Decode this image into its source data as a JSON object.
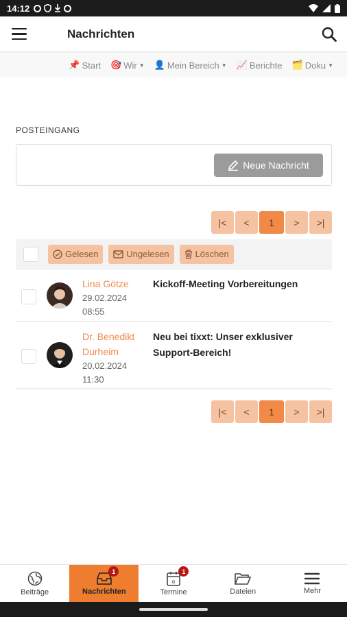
{
  "status_bar": {
    "time": "14:12"
  },
  "app_bar": {
    "title": "Nachrichten"
  },
  "top_nav": {
    "items": [
      {
        "icon": "pin-icon",
        "label": "Start",
        "dropdown": false
      },
      {
        "icon": "target-icon",
        "label": "Wir",
        "dropdown": true
      },
      {
        "icon": "person-icon",
        "label": "Mein Bereich",
        "dropdown": true
      },
      {
        "icon": "chart-icon",
        "label": "Berichte",
        "dropdown": false
      },
      {
        "icon": "folder-icon",
        "label": "Doku",
        "dropdown": true
      }
    ]
  },
  "inbox": {
    "section_label": "POSTEINGANG",
    "new_message_label": "Neue Nachricht",
    "pagination": {
      "current_page": "1",
      "first": "|<",
      "prev": "<",
      "next": ">",
      "last": ">|"
    },
    "toolbar": {
      "read_label": "Gelesen",
      "unread_label": "Ungelesen",
      "delete_label": "Löschen"
    },
    "messages": [
      {
        "sender": "Lina Götze",
        "date": "29.02.2024",
        "time": "08:55",
        "subject": "Kickoff-Meeting Vorbereitungen"
      },
      {
        "sender_line1": "Dr. Benedikt",
        "sender_line2": "Durheim",
        "date": "20.02.2024",
        "time": "11:30",
        "subject": "Neu bei tixxt: Unser exklusiver Support-Bereich!"
      }
    ]
  },
  "bottom_nav": {
    "items": [
      {
        "label": "Beiträge",
        "icon": "globe-icon",
        "badge": ""
      },
      {
        "label": "Nachrichten",
        "icon": "inbox-icon",
        "badge": "1",
        "active": true
      },
      {
        "label": "Termine",
        "icon": "calendar-icon",
        "badge": "1"
      },
      {
        "label": "Dateien",
        "icon": "folder-icon",
        "badge": ""
      },
      {
        "label": "Mehr",
        "icon": "menu-icon",
        "badge": ""
      }
    ]
  },
  "colors": {
    "accent": "#ee7d30",
    "accent_light": "#f6c3a2",
    "badge": "#b81515",
    "sender": "#ee8a4d"
  }
}
